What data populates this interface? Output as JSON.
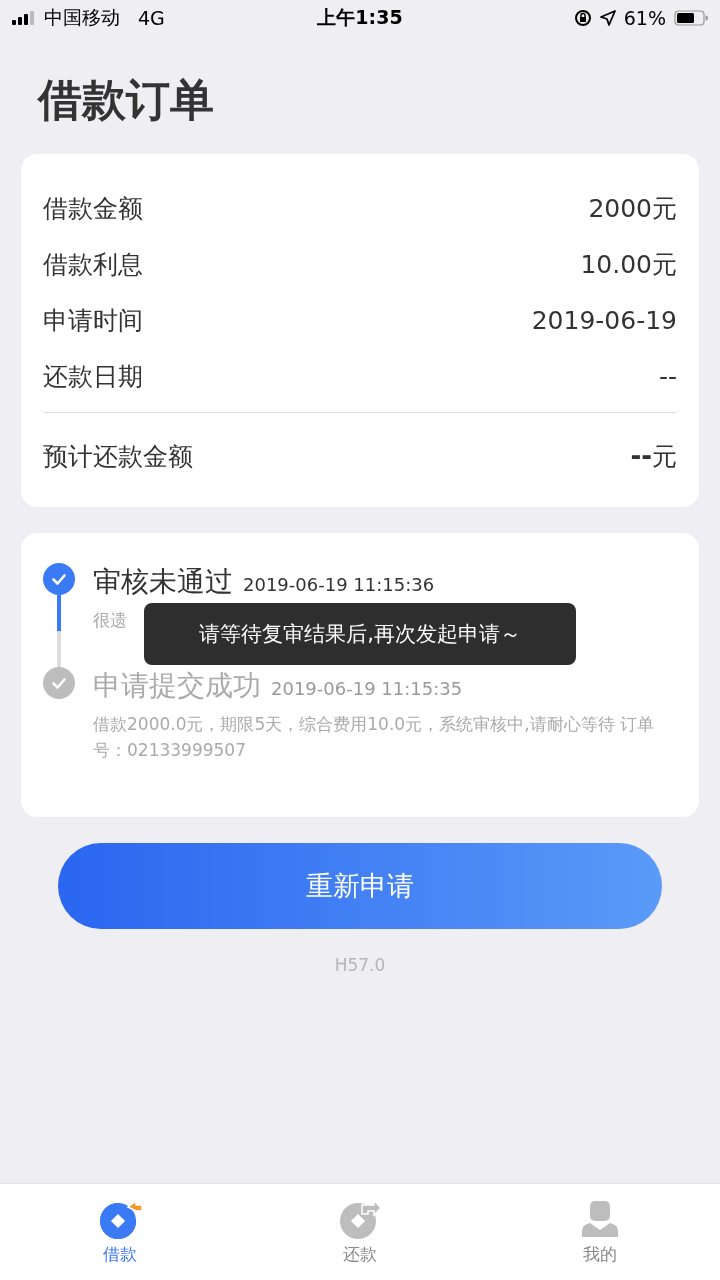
{
  "status_bar": {
    "carrier": "中国移动",
    "network": "4G",
    "time": "上午1:35",
    "battery": "61%"
  },
  "title": "借款订单",
  "details": [
    {
      "label": "借款金额",
      "value": "2000元"
    },
    {
      "label": "借款利息",
      "value": "10.00元"
    },
    {
      "label": "申请时间",
      "value": "2019-06-19"
    },
    {
      "label": "还款日期",
      "value": "--"
    }
  ],
  "total": {
    "label": "预计还款金额",
    "value": "--",
    "unit": "元"
  },
  "steps": [
    {
      "title": "审核未通过",
      "time": "2019-06-19 11:15:36",
      "detail": "很遗",
      "active": true
    },
    {
      "title": "申请提交成功",
      "time": "2019-06-19 11:15:35",
      "detail": "借款2000.0元，期限5天，综合费用10.0元，系统审核中,请耐心等待 订单号：02133999507",
      "active": false
    }
  ],
  "button": "重新申请",
  "version": "H57.0",
  "toast": "请等待复审结果后,再次发起申请～",
  "tabs": [
    {
      "label": "借款",
      "kind": "borrow",
      "selected": true
    },
    {
      "label": "还款",
      "kind": "repay",
      "selected": false
    },
    {
      "label": "我的",
      "kind": "profile",
      "selected": false
    }
  ]
}
